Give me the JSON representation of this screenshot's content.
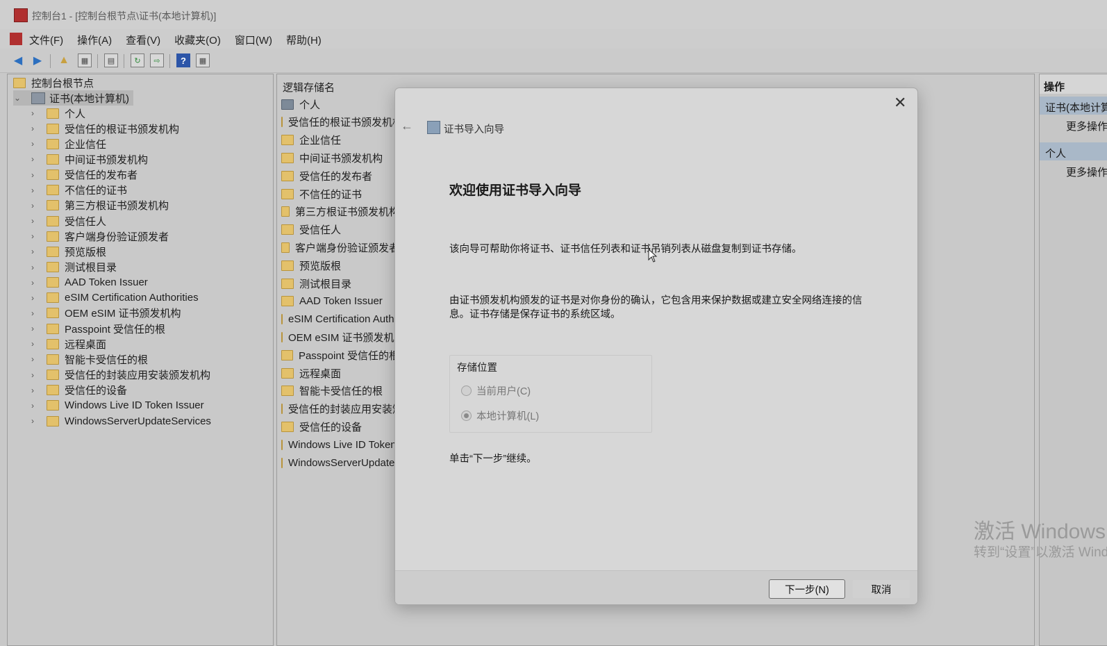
{
  "window": {
    "title": "控制台1 - [控制台根节点\\证书(本地计算机)]"
  },
  "menu": [
    "文件(F)",
    "操作(A)",
    "查看(V)",
    "收藏夹(O)",
    "窗口(W)",
    "帮助(H)"
  ],
  "tree": {
    "root": "控制台根节点",
    "node": "证书(本地计算机)",
    "children": [
      "个人",
      "受信任的根证书颁发机构",
      "企业信任",
      "中间证书颁发机构",
      "受信任的发布者",
      "不信任的证书",
      "第三方根证书颁发机构",
      "受信任人",
      "客户端身份验证颁发者",
      "预览版根",
      "测试根目录",
      "AAD Token Issuer",
      "eSIM Certification Authorities",
      "OEM eSIM 证书颁发机构",
      "Passpoint 受信任的根",
      "远程桌面",
      "智能卡受信任的根",
      "受信任的封装应用安装颁发机构",
      "受信任的设备",
      "Windows Live ID Token Issuer",
      "WindowsServerUpdateServices"
    ]
  },
  "list": {
    "header": "逻辑存储名",
    "items": [
      "个人",
      "受信任的根证书颁发机构",
      "企业信任",
      "中间证书颁发机构",
      "受信任的发布者",
      "不信任的证书",
      "第三方根证书颁发机构",
      "受信任人",
      "客户端身份验证颁发者",
      "预览版根",
      "测试根目录",
      "AAD Token Issuer",
      "eSIM Certification Authorities",
      "OEM eSIM 证书颁发机构",
      "Passpoint 受信任的根",
      "远程桌面",
      "智能卡受信任的根",
      "受信任的封装应用安装颁发机构",
      "受信任的设备",
      "Windows Live ID Token Issuer",
      "WindowsServerUpdateServices"
    ]
  },
  "actions": {
    "header": "操作",
    "section1": "证书(本地计算机)",
    "more1": "更多操作",
    "section2": "个人",
    "more2": "更多操作"
  },
  "watermark": {
    "line1": "激活 Windows",
    "line2": "转到“设置”以激活 Windows。"
  },
  "dialog": {
    "wizard_title": "证书导入向导",
    "heading": "欢迎使用证书导入向导",
    "para1": "该向导可帮助你将证书、证书信任列表和证书吊销列表从磁盘复制到证书存储。",
    "para2": "由证书颁发机构颁发的证书是对你身份的确认，它包含用来保护数据或建立安全网络连接的信息。证书存储是保存证书的系统区域。",
    "storage_label": "存储位置",
    "option_current_user": "当前用户(C)",
    "option_local_machine": "本地计算机(L)",
    "selected_option": "本地计算机(L)",
    "para3": "单击“下一步”继续。",
    "next_button": "下一步(N)",
    "cancel_button": "取消"
  }
}
